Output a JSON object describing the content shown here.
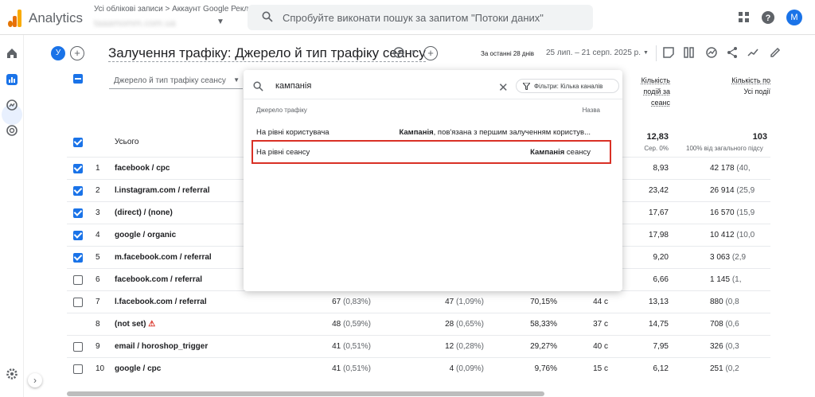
{
  "topbar": {
    "app_name": "Analytics",
    "account_path": "Усі облікові записи > Аккаунт Google Рекла...",
    "account_name": "taaamomm.com.ua",
    "search_placeholder": "Спробуйте виконати пошук за запитом \"Потоки даних\"",
    "avatar_letter": "M",
    "brand_colors": [
      "#f9ab00",
      "#e37400",
      "#e8710a"
    ]
  },
  "report": {
    "comparison_chip": "У",
    "title": "Залучення трафіку: Джерело й тип трафіку сеансу",
    "date_label": "За останні 28 днів",
    "date_range": "25 лип. – 21 серп. 2025 р."
  },
  "table": {
    "dimension_select": "Джерело й тип трафіку сеансу",
    "total_label": "Усього",
    "col_headers": [
      {
        "line1": "Кількість",
        "line2": "подій за",
        "line3": "сеанс"
      },
      {
        "line1": "Кількість по",
        "line2": "Усі події",
        "line3": ""
      }
    ],
    "totals": {
      "events_per_session": "12,83",
      "events_per_session_sub": "Сер. 0%",
      "event_count": "103",
      "event_count_sub": "100% від загального підсу"
    },
    "rows": [
      {
        "n": "1",
        "dim": "facebook / cpc",
        "checked": true,
        "c1": "",
        "c1p": "",
        "c2": "",
        "c2p": "",
        "c3": "",
        "c4": "",
        "c5": "8,93",
        "c6": "42 178",
        "c6p": "(40,"
      },
      {
        "n": "2",
        "dim": "l.instagram.com / referral",
        "checked": true,
        "c1": "",
        "c1p": "",
        "c2": "",
        "c2p": "",
        "c3": "",
        "c4": "",
        "c5": "23,42",
        "c6": "26 914",
        "c6p": "(25,9"
      },
      {
        "n": "3",
        "dim": "(direct) / (none)",
        "checked": true,
        "c1": "",
        "c1p": "",
        "c2": "",
        "c2p": "",
        "c3": "",
        "c4": "",
        "c5": "17,67",
        "c6": "16 570",
        "c6p": "(15,9"
      },
      {
        "n": "4",
        "dim": "google / organic",
        "checked": true,
        "c1": "",
        "c1p": "",
        "c2": "",
        "c2p": "",
        "c3": "",
        "c4": "",
        "c5": "17,98",
        "c6": "10 412",
        "c6p": "(10,0"
      },
      {
        "n": "5",
        "dim": "m.facebook.com / referral",
        "checked": true,
        "c1": "",
        "c1p": "",
        "c2": "",
        "c2p": "",
        "c3": "",
        "c4": "",
        "c5": "9,20",
        "c6": "3 063",
        "c6p": "(2,9"
      },
      {
        "n": "6",
        "dim": "facebook.com / referral",
        "checked": false,
        "c1": "",
        "c1p": "",
        "c2": "",
        "c2p": "",
        "c3": "",
        "c4": "",
        "c5": "6,66",
        "c6": "1 145",
        "c6p": "(1,"
      },
      {
        "n": "7",
        "dim": "l.facebook.com / referral",
        "checked": false,
        "c1": "67",
        "c1p": "(0,83%)",
        "c2": "47",
        "c2p": "(1,09%)",
        "c3": "70,15%",
        "c4": "44 с",
        "c5": "13,13",
        "c6": "880",
        "c6p": "(0,8"
      },
      {
        "n": "8",
        "dim": "(not set)",
        "checked": null,
        "warn": "⚠",
        "c1": "48",
        "c1p": "(0,59%)",
        "c2": "28",
        "c2p": "(0,65%)",
        "c3": "58,33%",
        "c4": "37 с",
        "c5": "14,75",
        "c6": "708",
        "c6p": "(0,6"
      },
      {
        "n": "9",
        "dim": "email / horoshop_trigger",
        "checked": false,
        "c1": "41",
        "c1p": "(0,51%)",
        "c2": "12",
        "c2p": "(0,28%)",
        "c3": "29,27%",
        "c4": "40 с",
        "c5": "7,95",
        "c6": "326",
        "c6p": "(0,3"
      },
      {
        "n": "10",
        "dim": "google / cpc",
        "checked": false,
        "c1": "41",
        "c1p": "(0,51%)",
        "c2": "4",
        "c2p": "(0,09%)",
        "c3": "9,76%",
        "c4": "15 с",
        "c5": "6,12",
        "c6": "251",
        "c6p": "(0,2"
      }
    ]
  },
  "dropdown": {
    "query": "кампанія",
    "filter_chip": "Фільтри: Кілька каналів",
    "col_source": "Джерело трафіку",
    "col_name": "Назва",
    "options": [
      {
        "source": "На рівні користувача",
        "name_bold": "Кампанія",
        "name_rest": ", пов'язана з першим залученням користув..."
      },
      {
        "source": "На рівні сеансу",
        "name_bold": "Кампанія",
        "name_rest": " сеансу"
      }
    ],
    "highlight_color": "#d93025"
  }
}
